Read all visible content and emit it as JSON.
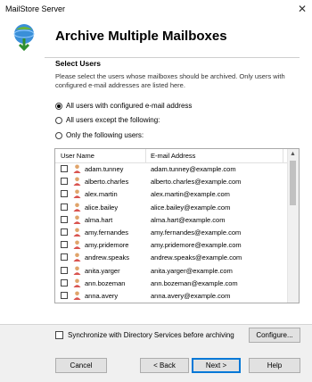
{
  "window": {
    "title": "MailStore Server"
  },
  "header": {
    "title": "Archive Multiple Mailboxes"
  },
  "section": {
    "title": "Select Users",
    "description": "Please select the users whose mailboxes should be archived. Only users with configured e-mail addresses are listed here."
  },
  "options": [
    {
      "label": "All users with configured e-mail address",
      "selected": true
    },
    {
      "label": "All users except the following:",
      "selected": false
    },
    {
      "label": "Only the following users:",
      "selected": false
    }
  ],
  "table": {
    "columns": [
      "User Name",
      "E-mail Address"
    ],
    "rows": [
      {
        "user": "adam.tunney",
        "email": "adam.tunney@example.com"
      },
      {
        "user": "alberto.charles",
        "email": "alberto.charles@example.com"
      },
      {
        "user": "alex.martin",
        "email": "alex.martin@example.com"
      },
      {
        "user": "alice.bailey",
        "email": "alice.bailey@example.com"
      },
      {
        "user": "alma.hart",
        "email": "alma.hart@example.com"
      },
      {
        "user": "amy.fernandes",
        "email": "amy.fernandes@example.com"
      },
      {
        "user": "amy.pridemore",
        "email": "amy.pridemore@example.com"
      },
      {
        "user": "andrew.speaks",
        "email": "andrew.speaks@example.com"
      },
      {
        "user": "anita.yarger",
        "email": "anita.yarger@example.com"
      },
      {
        "user": "ann.bozeman",
        "email": "ann.bozeman@example.com"
      },
      {
        "user": "anna.avery",
        "email": "anna.avery@example.com"
      }
    ]
  },
  "sync": {
    "label": "Synchronize with Directory Services before archiving",
    "button": "Configure..."
  },
  "buttons": {
    "cancel": "Cancel",
    "back": "< Back",
    "next": "Next >",
    "help": "Help"
  },
  "colors": {
    "accent": "#0078d7"
  }
}
